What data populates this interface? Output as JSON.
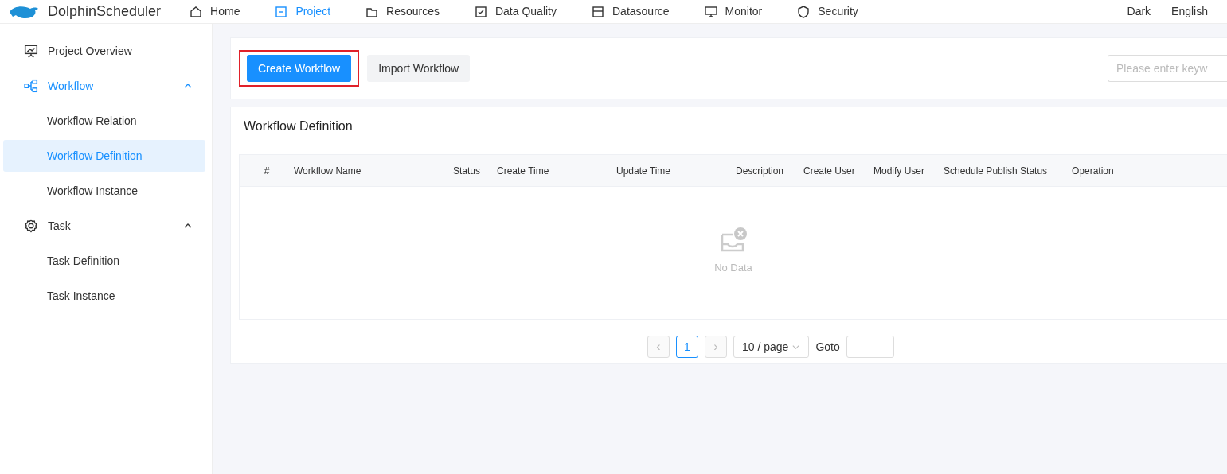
{
  "header": {
    "brand": "DolphinScheduler",
    "nav": [
      {
        "label": "Home",
        "kind": "home",
        "selected": false
      },
      {
        "label": "Project",
        "kind": "project",
        "selected": true
      },
      {
        "label": "Resources",
        "kind": "folder",
        "selected": false
      },
      {
        "label": "Data Quality",
        "kind": "check",
        "selected": false
      },
      {
        "label": "Datasource",
        "kind": "database",
        "selected": false
      },
      {
        "label": "Monitor",
        "kind": "monitor",
        "selected": false
      },
      {
        "label": "Security",
        "kind": "shield",
        "selected": false
      }
    ],
    "theme": "Dark",
    "language": "English"
  },
  "sidebar": {
    "items": [
      {
        "label": "Project Overview",
        "kind": "chart",
        "selected": false
      },
      {
        "label": "Workflow",
        "kind": "workflow",
        "selected": true,
        "expanded": true,
        "children": [
          {
            "label": "Workflow Relation",
            "selected": false
          },
          {
            "label": "Workflow Definition",
            "selected": true
          },
          {
            "label": "Workflow Instance",
            "selected": false
          }
        ]
      },
      {
        "label": "Task",
        "kind": "gear",
        "selected": false,
        "expanded": true,
        "children": [
          {
            "label": "Task Definition",
            "selected": false
          },
          {
            "label": "Task Instance",
            "selected": false
          }
        ]
      }
    ]
  },
  "toolbar": {
    "buttons": [
      {
        "label": "Create Workflow",
        "kind": "primary",
        "highlighted": true
      },
      {
        "label": "Import Workflow",
        "kind": "secondary",
        "highlighted": false
      }
    ],
    "search": {
      "placeholder": "Please enter keyw"
    }
  },
  "table": {
    "title": "Workflow Definition",
    "columns": [
      "#",
      "Workflow Name",
      "Status",
      "Create Time",
      "Update Time",
      "Description",
      "Create User",
      "Modify User",
      "Schedule Publish Status",
      "Operation"
    ],
    "empty_text": "No Data"
  },
  "pagination": {
    "prev": "‹",
    "pages": [
      {
        "label": "1",
        "selected": true
      }
    ],
    "next": "›",
    "page_size": "10 / page",
    "goto_label": "Goto"
  }
}
